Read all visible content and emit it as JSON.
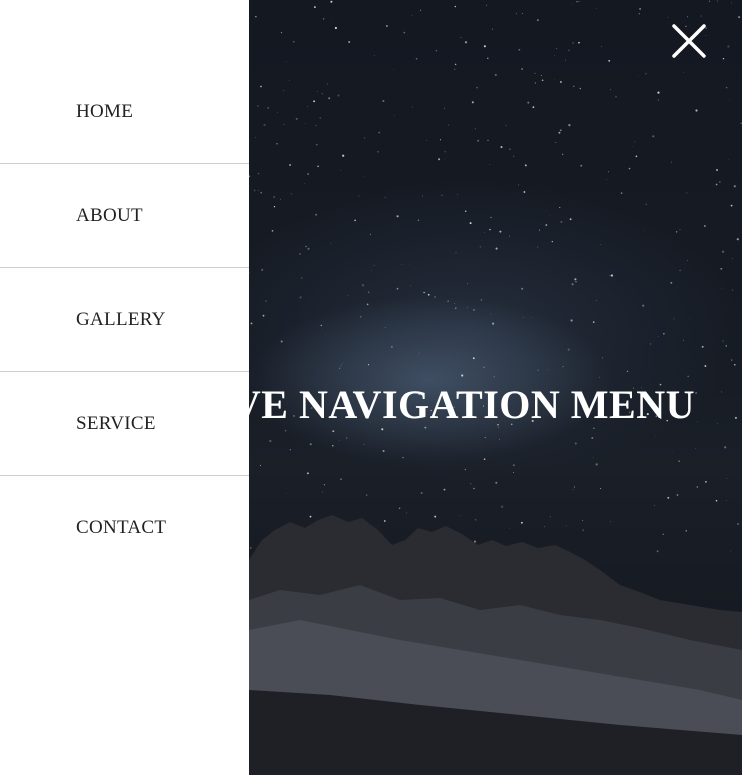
{
  "nav": {
    "items": [
      {
        "label": "HOME"
      },
      {
        "label": "ABOUT"
      },
      {
        "label": "GALLERY"
      },
      {
        "label": "SERVICE"
      },
      {
        "label": "CONTACT"
      }
    ]
  },
  "hero": {
    "title": "VE NAVIGATION MENU"
  },
  "close_button": {
    "icon": "close-icon"
  },
  "colors": {
    "drawer_bg": "#ffffff",
    "nav_text": "#222222",
    "hero_bg": "#11141b",
    "hero_text": "#ffffff"
  }
}
